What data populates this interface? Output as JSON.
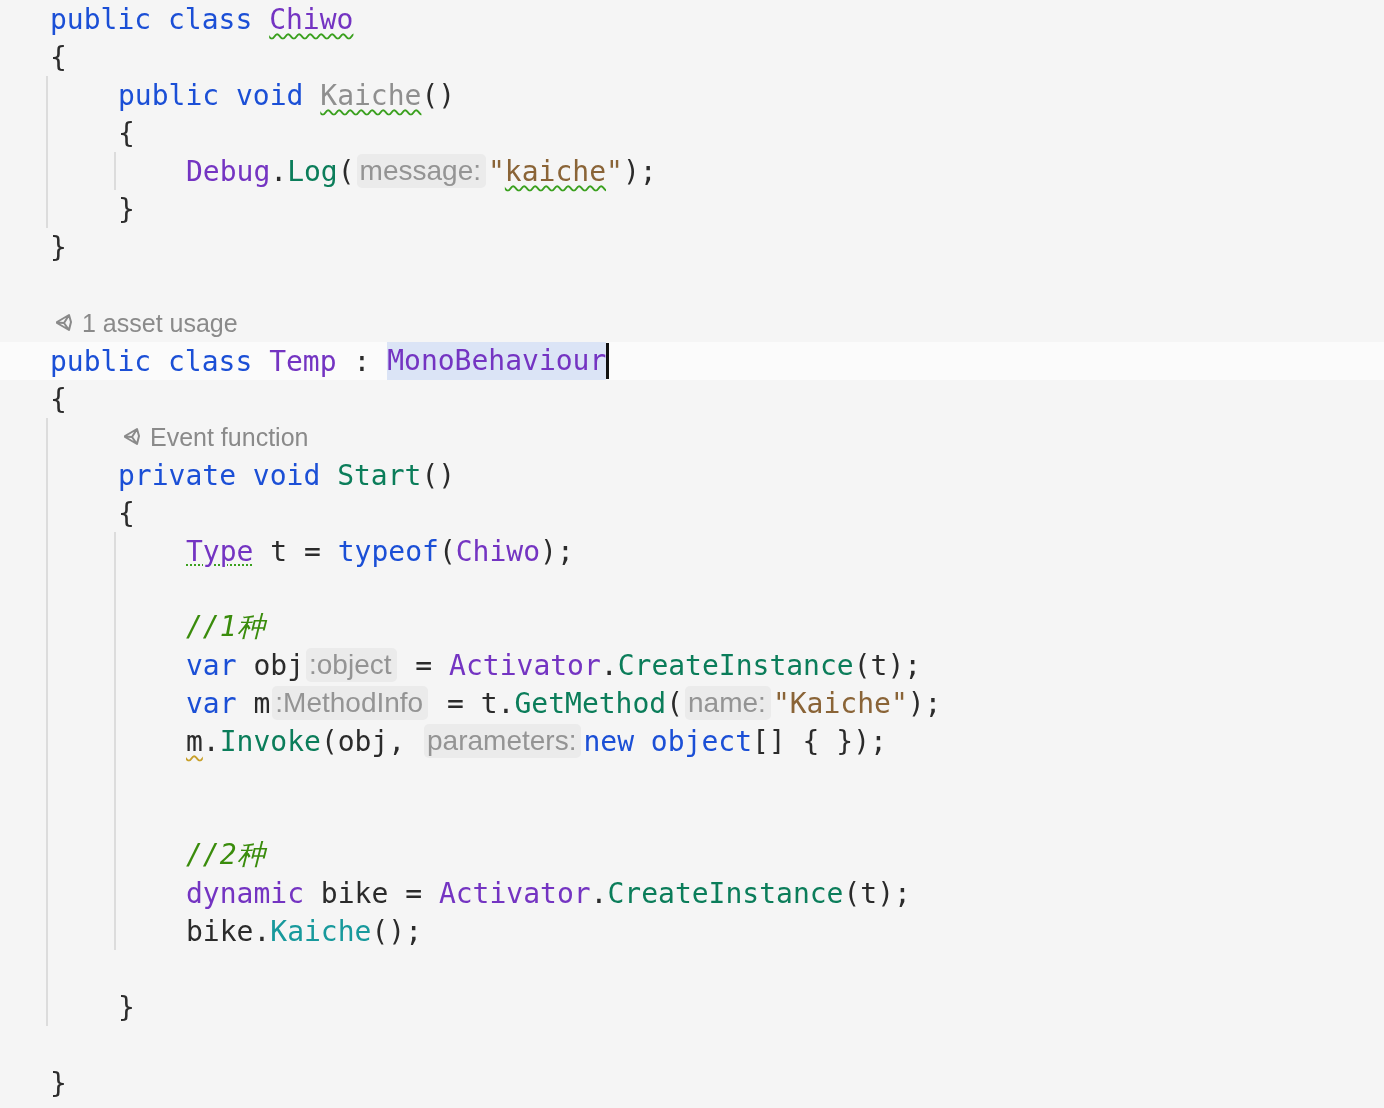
{
  "editor": {
    "lines": [
      {
        "kind": "code",
        "tokens": [
          {
            "text": "public class ",
            "kind": "keyword"
          },
          {
            "text": "Chiwo",
            "kind": "type",
            "squiggle": true
          }
        ]
      },
      {
        "kind": "code",
        "tokens": [
          {
            "text": "{",
            "kind": "plain"
          }
        ]
      },
      {
        "kind": "block",
        "children": [
          {
            "kind": "code",
            "tokens": [
              {
                "text": "public void ",
                "kind": "keyword"
              },
              {
                "text": "Kaiche",
                "kind": "unused",
                "squiggle": true
              },
              {
                "text": "()",
                "kind": "plain"
              }
            ]
          },
          {
            "kind": "code",
            "tokens": [
              {
                "text": "{",
                "kind": "plain"
              }
            ]
          },
          {
            "kind": "block",
            "children": [
              {
                "kind": "code",
                "tokens": [
                  {
                    "text": "Debug",
                    "kind": "type"
                  },
                  {
                    "text": ".",
                    "kind": "plain"
                  },
                  {
                    "text": "Log",
                    "kind": "method"
                  },
                  {
                    "text": "(",
                    "kind": "plain"
                  },
                  {
                    "text": "message:",
                    "kind": "hint"
                  },
                  {
                    "text": "\"",
                    "kind": "string"
                  },
                  {
                    "text": "kaiche",
                    "kind": "string",
                    "squiggle": true
                  },
                  {
                    "text": "\"",
                    "kind": "string"
                  },
                  {
                    "text": ");",
                    "kind": "plain"
                  }
                ]
              }
            ]
          },
          {
            "kind": "code",
            "tokens": [
              {
                "text": "}",
                "kind": "plain"
              }
            ]
          }
        ]
      },
      {
        "kind": "code",
        "tokens": [
          {
            "text": "}",
            "kind": "plain"
          }
        ]
      },
      {
        "kind": "blank"
      },
      {
        "kind": "lens",
        "text": "1 asset usage"
      },
      {
        "kind": "code",
        "current": true,
        "tokens": [
          {
            "text": "public class ",
            "kind": "keyword"
          },
          {
            "text": "Temp",
            "kind": "type"
          },
          {
            "text": " : ",
            "kind": "plain"
          },
          {
            "text": "MonoBehaviour",
            "kind": "type",
            "highlighted": true,
            "caret": true
          }
        ]
      },
      {
        "kind": "code",
        "tokens": [
          {
            "text": "{",
            "kind": "plain"
          }
        ]
      },
      {
        "kind": "block",
        "children": [
          {
            "kind": "lens",
            "text": "Event function"
          },
          {
            "kind": "code",
            "tokens": [
              {
                "text": "private void ",
                "kind": "keyword"
              },
              {
                "text": "Start",
                "kind": "method"
              },
              {
                "text": "()",
                "kind": "plain"
              }
            ]
          },
          {
            "kind": "code",
            "tokens": [
              {
                "text": "{",
                "kind": "plain"
              }
            ]
          },
          {
            "kind": "block",
            "children": [
              {
                "kind": "code",
                "tokens": [
                  {
                    "text": "Type",
                    "kind": "type",
                    "squiggle": true,
                    "dotted": true
                  },
                  {
                    "text": " t = ",
                    "kind": "plain"
                  },
                  {
                    "text": "typeof",
                    "kind": "keyword"
                  },
                  {
                    "text": "(",
                    "kind": "plain"
                  },
                  {
                    "text": "Chiwo",
                    "kind": "type"
                  },
                  {
                    "text": ");",
                    "kind": "plain"
                  }
                ]
              },
              {
                "kind": "blank"
              },
              {
                "kind": "code",
                "tokens": [
                  {
                    "text": "//1种",
                    "kind": "comment"
                  }
                ]
              },
              {
                "kind": "code",
                "tokens": [
                  {
                    "text": "var ",
                    "kind": "keyword"
                  },
                  {
                    "text": "obj",
                    "kind": "plain"
                  },
                  {
                    "text": ":object",
                    "kind": "hint"
                  },
                  {
                    "text": " = ",
                    "kind": "plain"
                  },
                  {
                    "text": "Activator",
                    "kind": "type"
                  },
                  {
                    "text": ".",
                    "kind": "plain"
                  },
                  {
                    "text": "CreateInstance",
                    "kind": "method"
                  },
                  {
                    "text": "(t);",
                    "kind": "plain"
                  }
                ]
              },
              {
                "kind": "code",
                "tokens": [
                  {
                    "text": "var ",
                    "kind": "keyword"
                  },
                  {
                    "text": "m",
                    "kind": "plain"
                  },
                  {
                    "text": ":MethodInfo",
                    "kind": "hint"
                  },
                  {
                    "text": " = t.",
                    "kind": "plain"
                  },
                  {
                    "text": "GetMethod",
                    "kind": "method"
                  },
                  {
                    "text": "(",
                    "kind": "plain"
                  },
                  {
                    "text": "name:",
                    "kind": "hint"
                  },
                  {
                    "text": "\"Kaiche\"",
                    "kind": "string"
                  },
                  {
                    "text": ");",
                    "kind": "plain"
                  }
                ]
              },
              {
                "kind": "code",
                "tokens": [
                  {
                    "text": "m",
                    "kind": "plain",
                    "squiggle": true,
                    "warning": true
                  },
                  {
                    "text": ".",
                    "kind": "plain"
                  },
                  {
                    "text": "Invoke",
                    "kind": "method"
                  },
                  {
                    "text": "(obj, ",
                    "kind": "plain"
                  },
                  {
                    "text": "parameters:",
                    "kind": "hint"
                  },
                  {
                    "text": "new object",
                    "kind": "keyword"
                  },
                  {
                    "text": "[] { });",
                    "kind": "plain"
                  }
                ]
              },
              {
                "kind": "blank"
              },
              {
                "kind": "blank"
              },
              {
                "kind": "code",
                "tokens": [
                  {
                    "text": "//2种",
                    "kind": "comment"
                  }
                ]
              },
              {
                "kind": "code",
                "tokens": [
                  {
                    "text": "dynamic ",
                    "kind": "type"
                  },
                  {
                    "text": "bike = ",
                    "kind": "plain"
                  },
                  {
                    "text": "Activator",
                    "kind": "type"
                  },
                  {
                    "text": ".",
                    "kind": "plain"
                  },
                  {
                    "text": "CreateInstance",
                    "kind": "method"
                  },
                  {
                    "text": "(t);",
                    "kind": "plain"
                  }
                ]
              },
              {
                "kind": "code",
                "tokens": [
                  {
                    "text": "bike.",
                    "kind": "plain"
                  },
                  {
                    "text": "Kaiche",
                    "kind": "dynamic"
                  },
                  {
                    "text": "();",
                    "kind": "plain"
                  }
                ]
              }
            ]
          },
          {
            "kind": "blank"
          },
          {
            "kind": "code",
            "tokens": [
              {
                "text": "}",
                "kind": "plain"
              }
            ]
          }
        ]
      },
      {
        "kind": "blank"
      },
      {
        "kind": "code",
        "tokens": [
          {
            "text": "}",
            "kind": "plain"
          }
        ]
      }
    ]
  }
}
